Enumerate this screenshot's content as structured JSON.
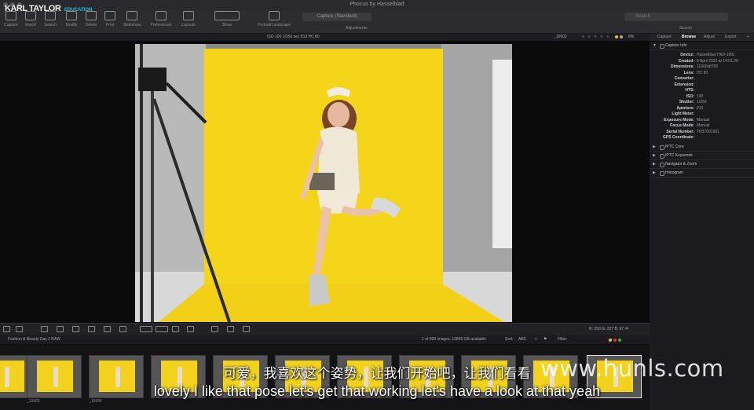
{
  "app": {
    "title": "Phocus by Hasselblad"
  },
  "branding": {
    "logo": "KARL TAYLOR",
    "logo_sub": "EDUCATION"
  },
  "toolbar": {
    "items": [
      "Capture",
      "Import",
      "Search",
      "Modify",
      "Delete",
      "Print",
      "Slideshow",
      "Preferences",
      "Layouts",
      "Show",
      "Portrait/Landscape"
    ],
    "recipe": "Capture (Standard)",
    "adjustments_label": "Adjustments",
    "search_placeholder": "Search",
    "search_label": "Search"
  },
  "info_strip": {
    "exif": "ISO 100  1/250 sec  f/13  HC 80",
    "filename": "_10602",
    "stars": "★ ★ ★ ★ ★",
    "zoom": "8%"
  },
  "inspector": {
    "tabs": [
      "Capture",
      "Browse",
      "Adjust",
      "Export"
    ],
    "active_tab": "Browse",
    "capture_info": {
      "title": "Capture Info",
      "rows": [
        {
          "k": "Device:",
          "v": "Hasselblad H6D-100c"
        },
        {
          "k": "Created:",
          "v": "8 April 2021 at 14:01:29"
        },
        {
          "k": "Dimensions:",
          "v": "11600x8700"
        },
        {
          "k": "Lens:",
          "v": "HC 80"
        },
        {
          "k": "Converter:",
          "v": ""
        },
        {
          "k": "Extension:",
          "v": ""
        },
        {
          "k": "HTS:",
          "v": ""
        },
        {
          "k": "ISO:",
          "v": "100"
        },
        {
          "k": "Shutter:",
          "v": "1/250"
        },
        {
          "k": "Aperture:",
          "v": "f/13"
        },
        {
          "k": "Light Meter:",
          "v": ""
        },
        {
          "k": "Exposure Mode:",
          "v": "Manual"
        },
        {
          "k": "Focus Mode:",
          "v": "Manual"
        },
        {
          "k": "Serial Number:",
          "v": "TR37001561"
        },
        {
          "k": "GPS Coordinate:",
          "v": ""
        }
      ]
    },
    "sections": [
      "IPTC Core",
      "IPTC Keywords",
      "Navigator & Zoom",
      "Histogram"
    ]
  },
  "bottom_tools": {
    "rgb_readout": "R: 250  G: 227  B: 67  /4"
  },
  "browser": {
    "album": "Fashion & Beauty Day 2 RAW",
    "count": "1 of 999 images, 10849 GB available",
    "sort_label": "Sort:",
    "sort_value": "ABC",
    "filter_label": "Filter:"
  },
  "filmstrip": {
    "labels": [
      "_10683",
      "_10684"
    ]
  },
  "subtitles": {
    "cn": "可爱，我喜欢这个姿势，让我们开始吧，让我们看看",
    "en": "lovely I like that pose let's get that working let's have a look at that yeah"
  },
  "watermark": "www.hunls.com",
  "colors": {
    "backdrop": "#f5d519",
    "accent": "#1ac6d6",
    "panel": "#1b1b1f"
  }
}
